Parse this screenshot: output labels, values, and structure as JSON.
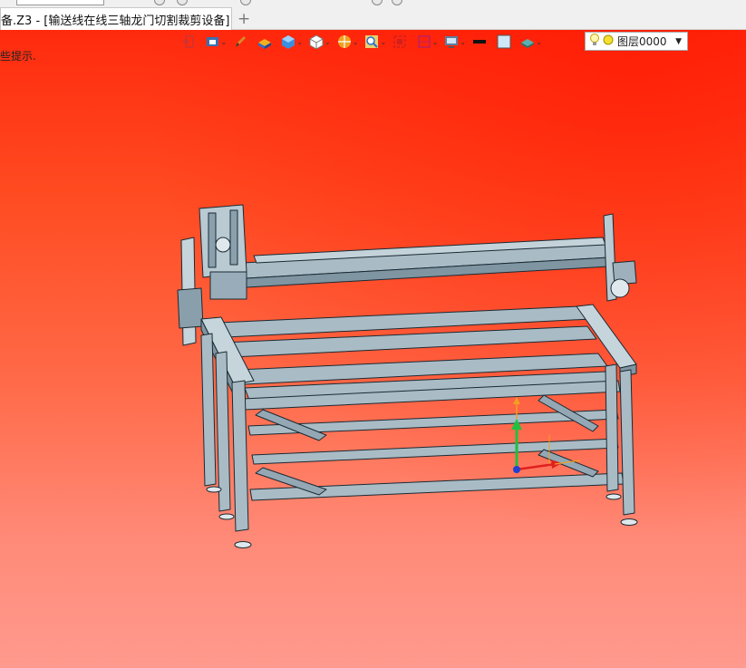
{
  "tab": {
    "title": "备.Z3 - [输送线在线三轴龙门切割裁剪设备]",
    "close_glyph": "✕",
    "new_tab_glyph": "+"
  },
  "toolbar": {
    "icons": [
      "exit-icon",
      "view-orient-icon",
      "pen-icon",
      "shade-icon",
      "cube-icon",
      "white-cube-icon",
      "render-mode-icon",
      "zoom-icon",
      "section-icon",
      "frame-icon",
      "display-icon",
      "line-color-icon",
      "fill-color-icon",
      "layer-material-icon"
    ],
    "layer_value": "图层0000",
    "layer_icons": [
      "bulb-icon",
      "yellow-dot-icon"
    ]
  },
  "hint": "些提示.",
  "colors": {
    "viewport_top": "#ff2a0e",
    "viewport_bottom": "#ff9a8e",
    "model_fill": "#a9bcc6",
    "model_edge": "#1a2a33"
  }
}
